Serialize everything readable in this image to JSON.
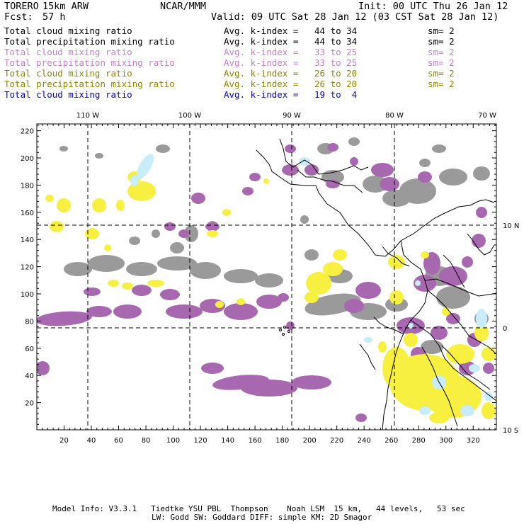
{
  "header": {
    "model": "TORERO",
    "resolution": "15km ARW",
    "center": "NCAR/MMM",
    "init": "Init: 00 UTC Thu 26 Jan 12",
    "fcst_label": "Fcst:",
    "fcst_value": "57 h",
    "valid": "Valid: 09 UTC Sat 28 Jan 12 (03 CST Sat 28 Jan 12)"
  },
  "legend_rows": [
    {
      "field": "Total cloud mixing ratio",
      "kindex": "Avg. k-index =",
      "range": "44 to 34",
      "sm": "sm= 2",
      "color": "#000000"
    },
    {
      "field": "Total precipitation mixing ratio",
      "kindex": "Avg. k-index =",
      "range": "44 to 34",
      "sm": "sm= 2",
      "color": "#000000"
    },
    {
      "field": "Total cloud mixing ratio",
      "kindex": "Avg. k-index =",
      "range": "33 to 25",
      "sm": "sm= 2",
      "color": "#c080c8"
    },
    {
      "field": "Total precipitation mixing ratio",
      "kindex": "Avg. k-index =",
      "range": "33 to 25",
      "sm": "sm= 2",
      "color": "#c080c8"
    },
    {
      "field": "Total cloud mixing ratio",
      "kindex": "Avg. k-index =",
      "range": "26 to 20",
      "sm": "sm= 2",
      "color": "#888800"
    },
    {
      "field": "Total precipitation mixing ratio",
      "kindex": "Avg. k-index =",
      "range": "26 to 20",
      "sm": "sm= 2",
      "color": "#888800"
    },
    {
      "field": "Total cloud mixing ratio",
      "kindex": "Avg. k-index =",
      "range": "19 to  4",
      "sm": "",
      "color": "#0000cc"
    }
  ],
  "axes": {
    "x_ticks": [
      "20",
      "40",
      "60",
      "80",
      "100",
      "120",
      "140",
      "160",
      "180",
      "200",
      "220",
      "240",
      "260",
      "280",
      "300",
      "320"
    ],
    "y_ticks": [
      "20",
      "40",
      "60",
      "80",
      "100",
      "120",
      "140",
      "160",
      "180",
      "200",
      "220"
    ],
    "lon_labels": [
      "110 W",
      "100 W",
      "90 W",
      "80 W",
      "70 W"
    ],
    "lat_labels": [
      "10 N",
      "0",
      "10 S"
    ]
  },
  "colors": {
    "gray_cloud": "#9a9a9a",
    "purple": "#a868b0",
    "yellow": "#f8f040",
    "light_blue": "#c8ecf8",
    "coast": "#000000"
  },
  "footer": {
    "line1": "Model Info: V3.3.1   Tiedtke YSU PBL  Thompson    Noah LSM  15 km,   44 levels,   53 sec",
    "line2": "LW: Godd SW: Goddard DIFF: simple KM: 2D Smagor"
  }
}
